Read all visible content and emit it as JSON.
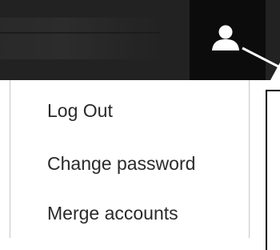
{
  "header": {
    "user_icon": "user-icon"
  },
  "user_menu": {
    "items": [
      {
        "label": "Log Out"
      },
      {
        "label": "Change password"
      },
      {
        "label": "Merge accounts"
      }
    ]
  },
  "colors": {
    "header_bg": "#222222",
    "user_button_bg": "#0c0c0c",
    "menu_text": "#2a2a2a",
    "menu_bg": "#ffffff"
  }
}
